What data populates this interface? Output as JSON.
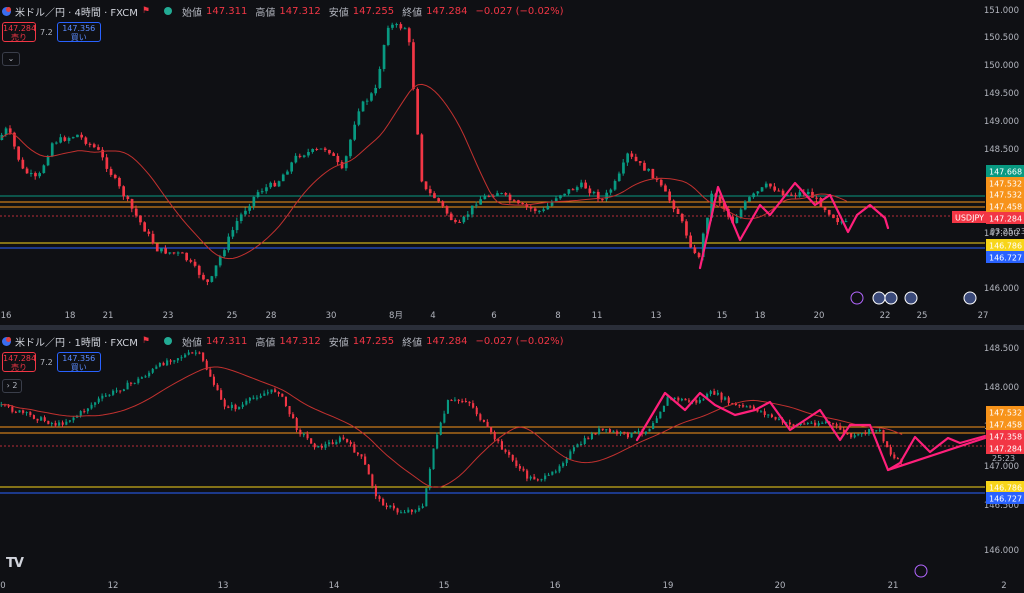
{
  "top": {
    "symbol": "米ドル／円 · 4時間 · FXCM",
    "ohlc": [
      {
        "label": "始値",
        "value": "147.311"
      },
      {
        "label": "高値",
        "value": "147.312"
      },
      {
        "label": "安値",
        "value": "147.255"
      },
      {
        "label": "終値",
        "value": "147.284"
      },
      {
        "label": "",
        "value": "−0.027 (−0.02%)"
      }
    ],
    "sell_price": "147.284",
    "sell_label": "売り",
    "spread": "7.2",
    "buy_price": "147.356",
    "buy_label": "買い",
    "axis_prices": [
      "151.000",
      "150.500",
      "150.000",
      "149.500",
      "149.000",
      "148.500",
      "147.000",
      "146.000"
    ],
    "price_tags": [
      {
        "text": "147.668",
        "color": "#089981"
      },
      {
        "text": "147.532",
        "color": "#f7931a"
      },
      {
        "text": "147.532",
        "color": "#f7931a"
      },
      {
        "text": "147.458",
        "color": "#f7931a"
      },
      {
        "text": "USDJPY",
        "color": "#f23645"
      },
      {
        "text": "147.284",
        "color": "#f23645"
      },
      {
        "text": "03:25:23",
        "color": "#f23645"
      },
      {
        "text": "146.786",
        "color": "#f7d51a"
      },
      {
        "text": "146.727",
        "color": "#2962ff"
      }
    ],
    "dates": [
      "16",
      "18",
      "21",
      "23",
      "25",
      "28",
      "30",
      "8月",
      "4",
      "6",
      "8",
      "11",
      "13",
      "15",
      "18",
      "20",
      "22",
      "25",
      "27"
    ],
    "event_icons": [
      "lightning-icon",
      "us-flag-icon",
      "jp-flag-icon",
      "us-flag-icon",
      "us-flag-icon"
    ]
  },
  "bottom": {
    "symbol": "米ドル／円 · 1時間 · FXCM",
    "ohlc": [
      {
        "label": "始値",
        "value": "147.311"
      },
      {
        "label": "高値",
        "value": "147.312"
      },
      {
        "label": "安値",
        "value": "147.255"
      },
      {
        "label": "終値",
        "value": "147.284"
      },
      {
        "label": "",
        "value": "−0.027 (−0.02%)"
      }
    ],
    "sell_price": "147.284",
    "sell_label": "売り",
    "spread": "7.2",
    "buy_price": "147.356",
    "buy_label": "買い",
    "collapse_label": "2",
    "axis_prices": [
      "148.500",
      "148.000",
      "147.500",
      "147.000",
      "146.500",
      "146.000"
    ],
    "price_tags": [
      {
        "text": "147.532",
        "color": "#f7931a"
      },
      {
        "text": "147.458",
        "color": "#f7931a"
      },
      {
        "text": "147.358",
        "color": "#f23645"
      },
      {
        "text": "147.284",
        "color": "#f23645"
      },
      {
        "text": "25:23",
        "color": "#f23645"
      },
      {
        "text": "146.786",
        "color": "#f7d51a"
      },
      {
        "text": "146.727",
        "color": "#2962ff"
      }
    ],
    "dates": [
      "0",
      "12",
      "13",
      "14",
      "15",
      "16",
      "19",
      "20",
      "21",
      "2"
    ],
    "logo": "TV"
  },
  "colors": {
    "up": "#089981",
    "down": "#f23645",
    "ma": "#c2312f",
    "draw": "#ff1f7a"
  }
}
